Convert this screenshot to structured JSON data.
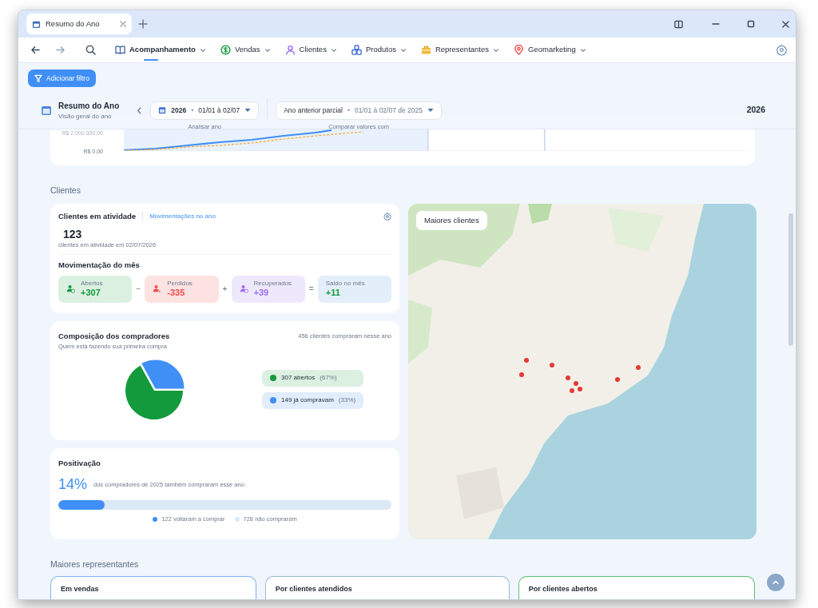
{
  "window": {
    "tab": {
      "title": "Resumo do Ano"
    }
  },
  "nav": {
    "items": [
      {
        "label": "Acompanhamento",
        "selected": true
      },
      {
        "label": "Vendas",
        "selected": false
      },
      {
        "label": "Clientes",
        "selected": false
      },
      {
        "label": "Produtos",
        "selected": false
      },
      {
        "label": "Representantes",
        "selected": false
      },
      {
        "label": "Geomarketing",
        "selected": false
      }
    ]
  },
  "filter_button": "Adicionar filtro",
  "header": {
    "title": "Resumo do Ano",
    "subtitle": "Visão geral do ano",
    "period": {
      "year": "2026",
      "separator": "•",
      "range": "01/01 à 02/07",
      "caption": "Analisar ano"
    },
    "compare": {
      "label": "Ano anterior parcial",
      "separator": "•",
      "range": "01/01 à 02/07 de 2025",
      "caption": "Comparar valores com"
    },
    "year_label": "2026"
  },
  "sales_chart": {
    "y_labels": [
      "R$ 2.000.000,00",
      "R$ 0,00"
    ]
  },
  "clients": {
    "heading": "Clientes",
    "activity": {
      "title": "Clientes em atividade",
      "link": "Movimentações no ano",
      "count": "123",
      "caption": "clientes em atividade em 02/07/2026",
      "month_title": "Movimentação do mês",
      "moves": [
        {
          "kind": "opened",
          "label": "Abertos",
          "value": "+307",
          "operator": "−"
        },
        {
          "kind": "lost",
          "label": "Perdidos",
          "value": "-335",
          "operator": "+"
        },
        {
          "kind": "recovered",
          "label": "Recuperados",
          "value": "+39",
          "operator": "="
        },
        {
          "kind": "balance",
          "label": "Saldo no mês",
          "value": "+11"
        }
      ]
    },
    "composition": {
      "title": "Composição dos compradores",
      "subtitle": "Quem está fazendo sua primeira compra",
      "total": "456 clientes compraram nesse ano",
      "chart_data": {
        "type": "pie",
        "values": [
          67,
          33
        ]
      },
      "legend": [
        {
          "label": "307 abertos",
          "share": "(67%)",
          "color": "#139a3c"
        },
        {
          "label": "149 já compravam",
          "share": "(33%)",
          "color": "#3f8ff7"
        }
      ]
    },
    "positivation": {
      "title": "Positivação",
      "percent": "14%",
      "text": "dos compradores de 2025 também compraram esse ano",
      "level": 0.14,
      "legend": [
        {
          "label": "122 voltaram a comprar",
          "color": "#3f8ff7"
        },
        {
          "label": "728 não compraram",
          "color": "#dde8f5"
        }
      ]
    },
    "map": {
      "title": "Maiores clientes"
    }
  },
  "representatives": {
    "heading": "Maiores representantes",
    "cards": [
      {
        "title": "Em vendas",
        "color": "#7fb0f5"
      },
      {
        "title": "Por clientes atendidos",
        "color": "#9ab5d6"
      },
      {
        "title": "Por clientes abertos",
        "color": "#5bbf73"
      }
    ]
  }
}
